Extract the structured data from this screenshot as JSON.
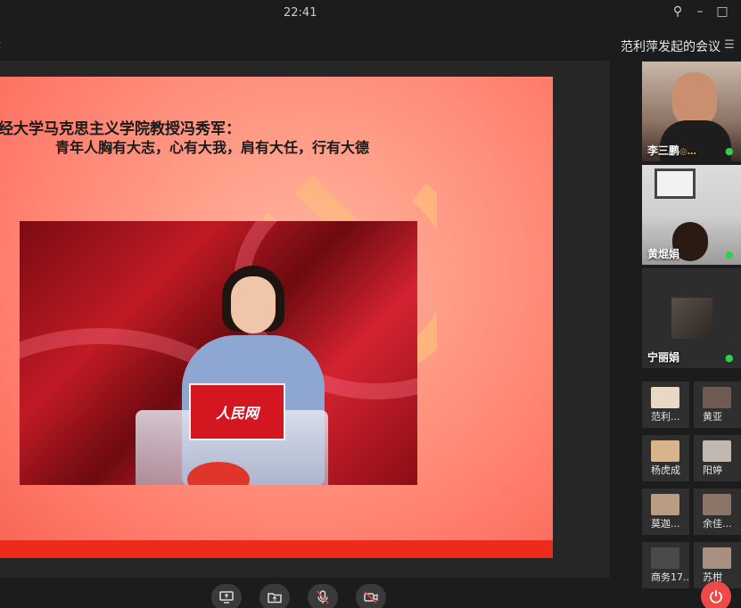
{
  "titlebar": {
    "clock": "22:41",
    "pin_icon": "pin-icon",
    "minimize_icon": "minimize-icon",
    "maximize_icon": "maximize-icon"
  },
  "meeting": {
    "title": "范利萍发起的会议"
  },
  "slide": {
    "line1": "经大学马克思主义学院教授冯秀军：",
    "line2": "青年人胸有大志，心有大我，肩有大任，行有大德",
    "lectern_sign": "人民网"
  },
  "participants_large": [
    {
      "name": "李三鹏",
      "suffix": "◎…"
    },
    {
      "name": "黄焜娟"
    },
    {
      "name": "宁丽娟"
    }
  ],
  "participants_small": [
    {
      "name": "范利..."
    },
    {
      "name": "黄亚"
    },
    {
      "name": "杨虎成"
    },
    {
      "name": "阳婷"
    },
    {
      "name": "莫迦..."
    },
    {
      "name": "余佳..."
    },
    {
      "name": "商务17..."
    },
    {
      "name": "苏柑"
    }
  ],
  "toolbar": {
    "share_icon": "screen-share-icon",
    "folder_icon": "folder-share-icon",
    "mic_icon": "microphone-icon",
    "camera_icon": "camera-off-icon",
    "leave_icon": "power-icon"
  },
  "colors": {
    "mic_active": "#2fd04a",
    "leave": "#f04848",
    "slide_bar": "#ec2b1d"
  }
}
